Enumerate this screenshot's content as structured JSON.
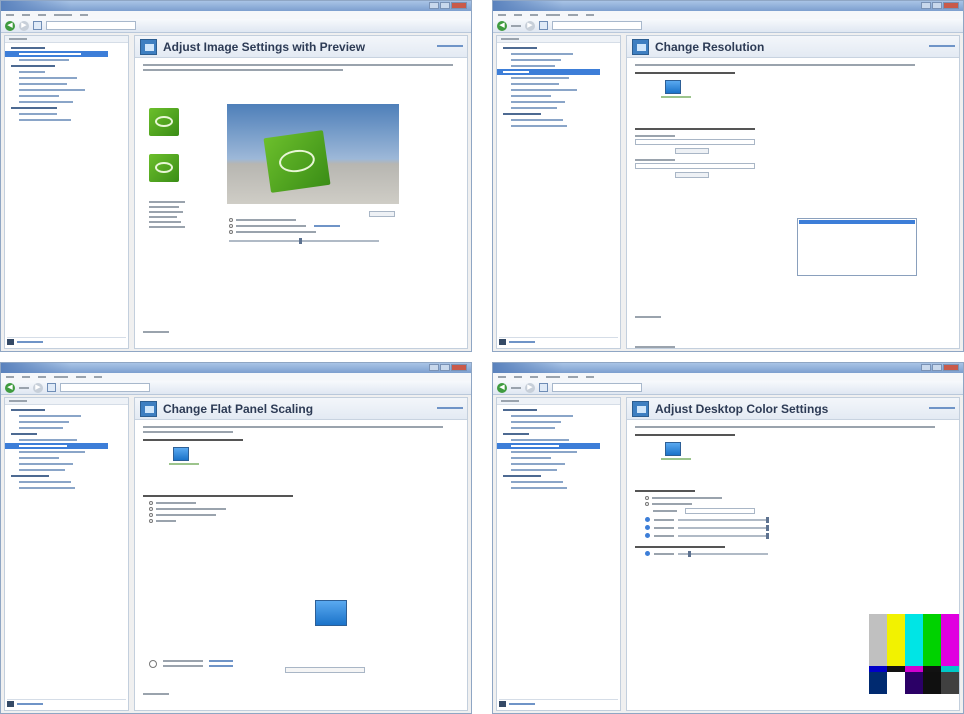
{
  "panels": [
    {
      "page_title": "Adjust Image Settings with Preview",
      "selected_tree_item": 1,
      "tree_items": [
        {
          "level": 0
        },
        {
          "level": 1
        },
        {
          "level": 1
        },
        {
          "level": 0
        },
        {
          "level": 1
        },
        {
          "level": 1
        },
        {
          "level": 1
        },
        {
          "level": 1
        },
        {
          "level": 1
        },
        {
          "level": 1
        },
        {
          "level": 0
        },
        {
          "level": 1
        },
        {
          "level": 1
        }
      ]
    },
    {
      "page_title": "Change Resolution",
      "selected_tree_item": 4,
      "tree_items": [
        {
          "level": 0
        },
        {
          "level": 1
        },
        {
          "level": 1
        },
        {
          "level": 1
        },
        {
          "level": 0
        },
        {
          "level": 1
        },
        {
          "level": 1
        },
        {
          "level": 1
        },
        {
          "level": 1
        },
        {
          "level": 1
        },
        {
          "level": 1
        },
        {
          "level": 0
        },
        {
          "level": 1
        },
        {
          "level": 1
        }
      ]
    },
    {
      "page_title": "Change Flat Panel Scaling",
      "selected_tree_item": 6,
      "tree_items": [
        {
          "level": 0
        },
        {
          "level": 1
        },
        {
          "level": 1
        },
        {
          "level": 1
        },
        {
          "level": 0
        },
        {
          "level": 1
        },
        {
          "level": 1
        },
        {
          "level": 1
        },
        {
          "level": 1
        },
        {
          "level": 1
        },
        {
          "level": 1
        },
        {
          "level": 0
        },
        {
          "level": 1
        },
        {
          "level": 1
        }
      ]
    },
    {
      "page_title": "Adjust Desktop Color Settings",
      "selected_tree_item": 6,
      "tree_items": [
        {
          "level": 0
        },
        {
          "level": 1
        },
        {
          "level": 1
        },
        {
          "level": 1
        },
        {
          "level": 0
        },
        {
          "level": 1
        },
        {
          "level": 1
        },
        {
          "level": 1
        },
        {
          "level": 1
        },
        {
          "level": 1
        },
        {
          "level": 1
        },
        {
          "level": 0
        },
        {
          "level": 1
        },
        {
          "level": 1
        }
      ]
    }
  ],
  "colors": {
    "accent": "#3d7ed8",
    "title_bar": "#7d9fcf",
    "nvidia_green": "#6cbf2c"
  },
  "color_bars": {
    "top": [
      "#c0c0c0",
      "#f2f200",
      "#00e5e5",
      "#00d200",
      "#e000e0"
    ],
    "mid": [
      "#0000c8",
      "#121212",
      "#d000d0",
      "#121212",
      "#00c8c8"
    ],
    "bottom": [
      "#002a70",
      "#ffffff",
      "#2b0066",
      "#101010",
      "#404040"
    ]
  },
  "icons": [
    "back-icon",
    "forward-icon",
    "home-icon",
    "system-information-icon",
    "monitor-icon"
  ]
}
